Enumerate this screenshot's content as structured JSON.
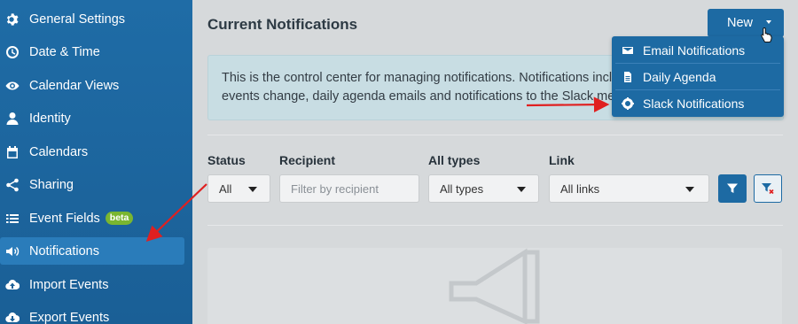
{
  "sidebar": {
    "items": [
      {
        "label": "General Settings",
        "icon": "gear-icon"
      },
      {
        "label": "Date & Time",
        "icon": "clock-icon"
      },
      {
        "label": "Calendar Views",
        "icon": "eye-icon"
      },
      {
        "label": "Identity",
        "icon": "user-icon"
      },
      {
        "label": "Calendars",
        "icon": "calendar-icon"
      },
      {
        "label": "Sharing",
        "icon": "share-icon"
      },
      {
        "label": "Event Fields",
        "icon": "list-icon",
        "badge": "beta"
      },
      {
        "label": "Notifications",
        "icon": "megaphone-icon",
        "active": true
      },
      {
        "label": "Import Events",
        "icon": "cloud-upload-icon"
      },
      {
        "label": "Export Events",
        "icon": "cloud-download-icon"
      }
    ]
  },
  "main": {
    "title": "Current Notifications",
    "new_button": "New",
    "info_line1": "This is the control center for managing notifications. Notifications inclu",
    "info_line2": "events change, daily agenda emails and notifications to the Slack mess"
  },
  "filters": {
    "status_label": "Status",
    "status_value": "All",
    "recipient_label": "Recipient",
    "recipient_placeholder": "Filter by recipient",
    "types_label": "All types",
    "types_value": "All types",
    "link_label": "Link",
    "link_value": "All links"
  },
  "new_menu": {
    "items": [
      {
        "label": "Email Notifications",
        "icon": "envelope-icon"
      },
      {
        "label": "Daily Agenda",
        "icon": "document-icon"
      },
      {
        "label": "Slack Notifications",
        "icon": "slack-icon"
      }
    ]
  },
  "colors": {
    "sidebar": "#1f6ca6",
    "accent": "#1d6aa3",
    "annotation_arrow": "#e02020",
    "badge": "#7ab630"
  }
}
